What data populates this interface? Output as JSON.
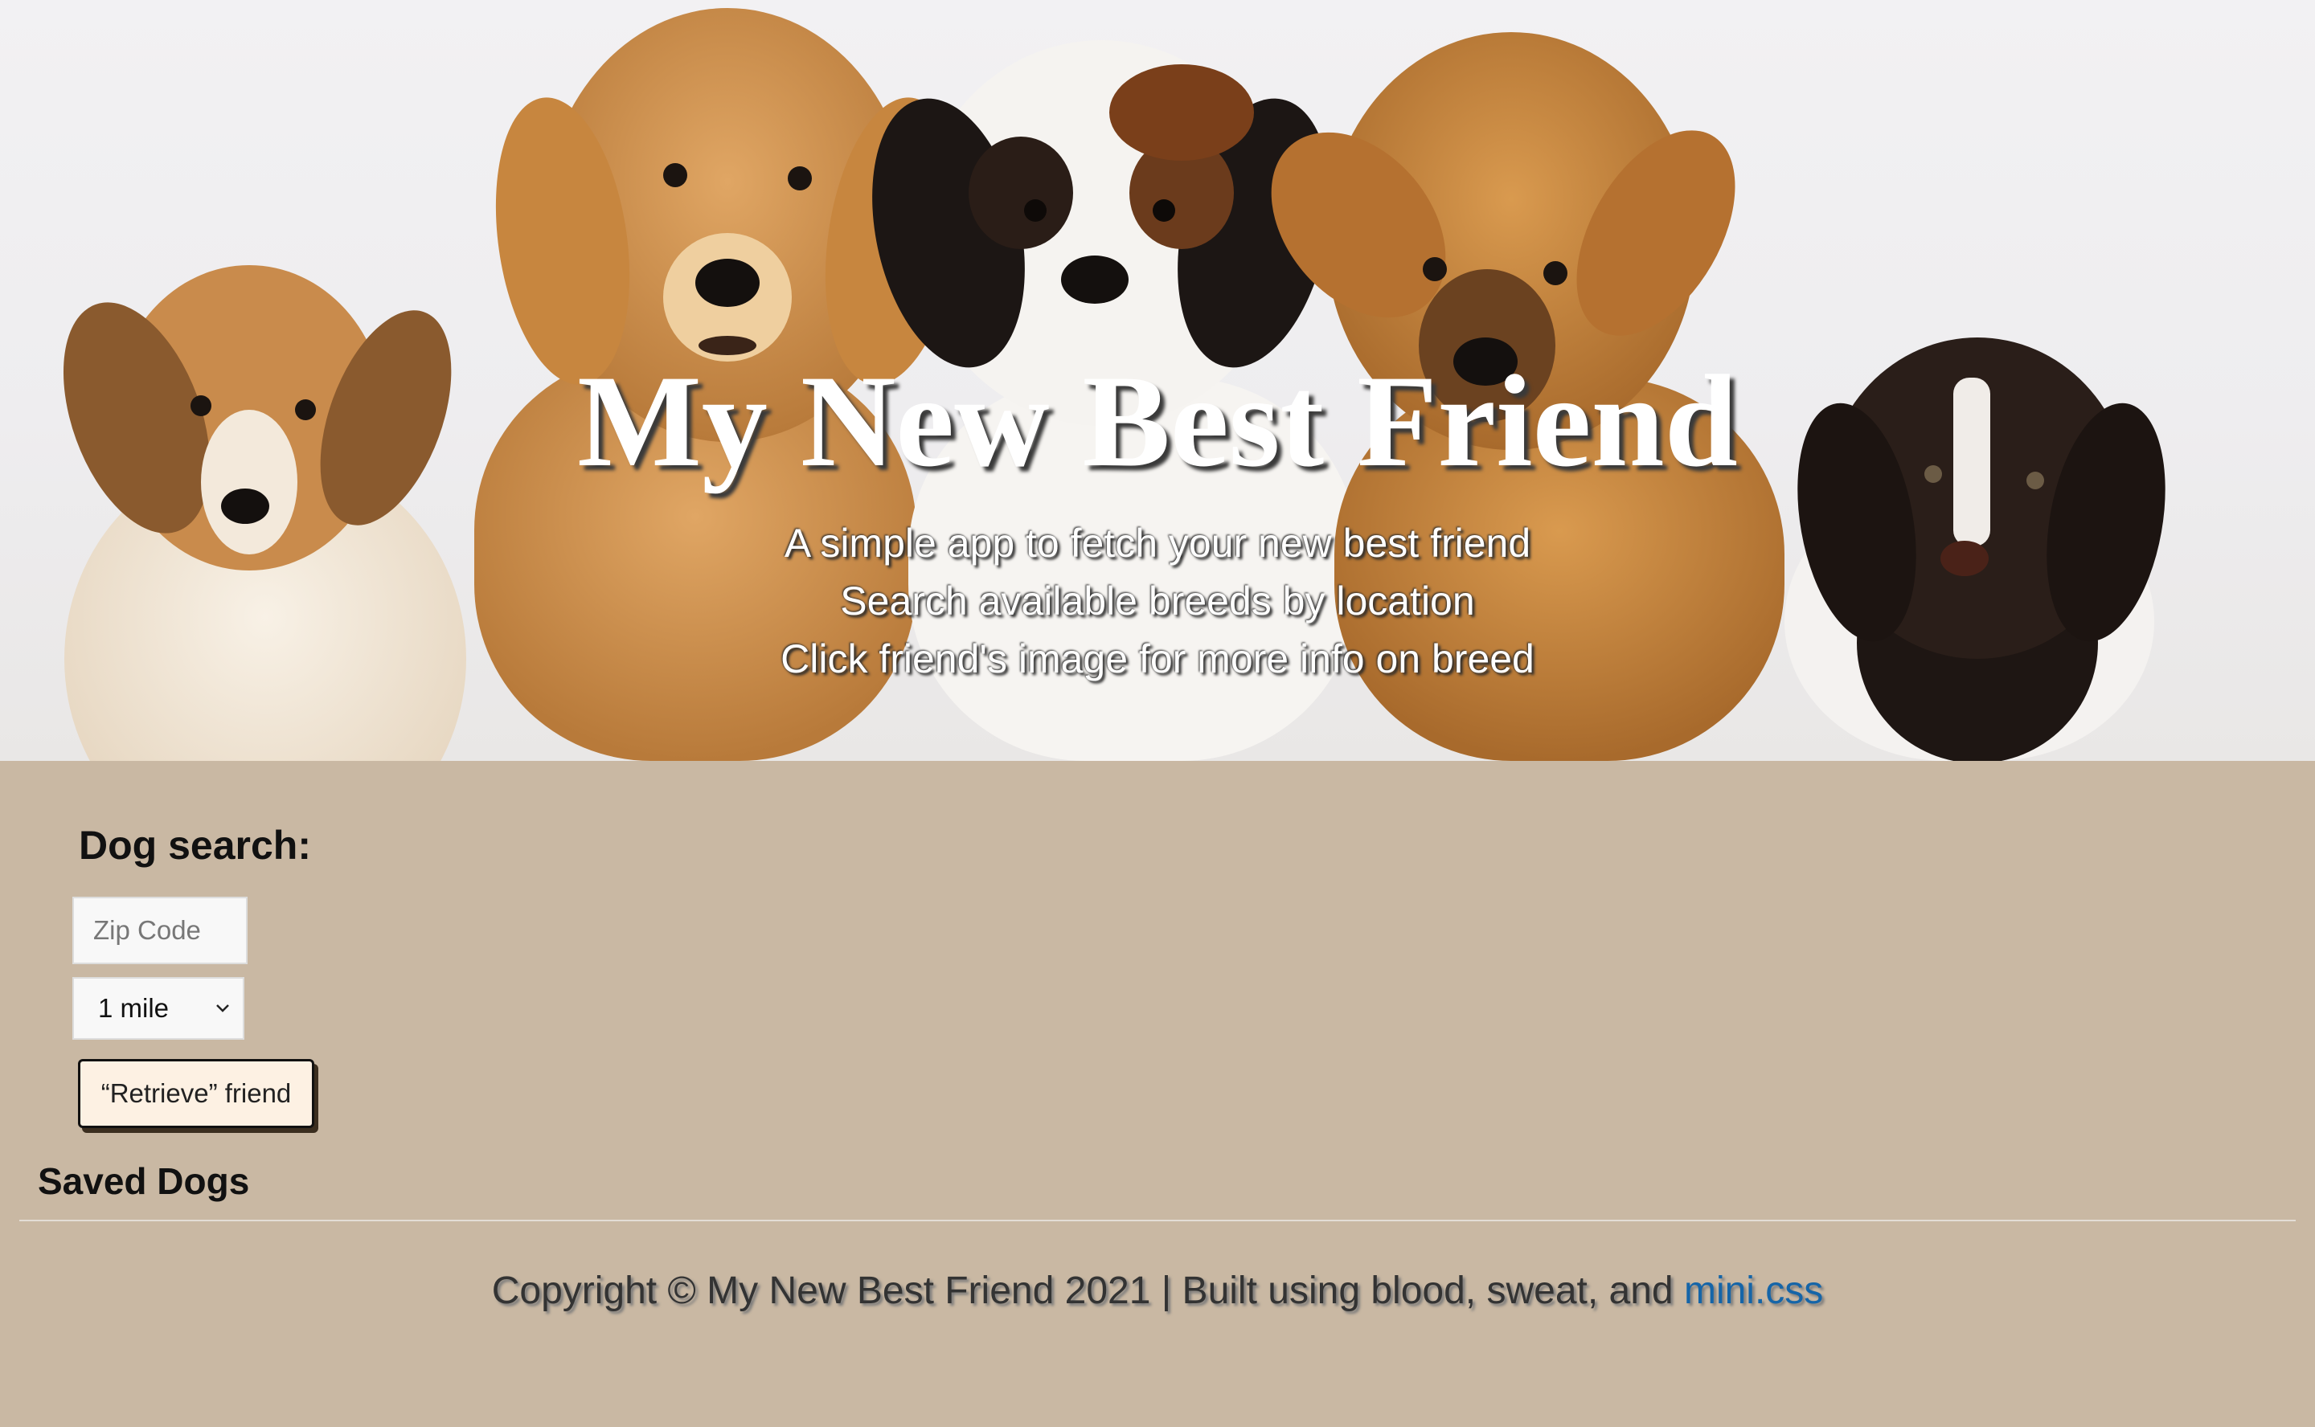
{
  "hero": {
    "image": "five-puppies-banner",
    "title": "My New Best Friend",
    "lines": [
      "A simple app to fetch your new best friend",
      "Search available breeds by location",
      "Click friend's image for more info on breed"
    ]
  },
  "search": {
    "title": "Dog search:",
    "zip_placeholder": "Zip Code",
    "zip_value": "",
    "radius_selected": "1 mile",
    "retrieve_label": "“Retrieve” friend"
  },
  "saved": {
    "title": "Saved Dogs"
  },
  "footer": {
    "text": "Copyright © My New Best Friend 2021 | Built using blood, sweat, and ",
    "link_label": "mini.css"
  },
  "colors": {
    "page_background": "#c9b8a3",
    "button_background": "#fdf1e3",
    "link": "#1565a8"
  }
}
